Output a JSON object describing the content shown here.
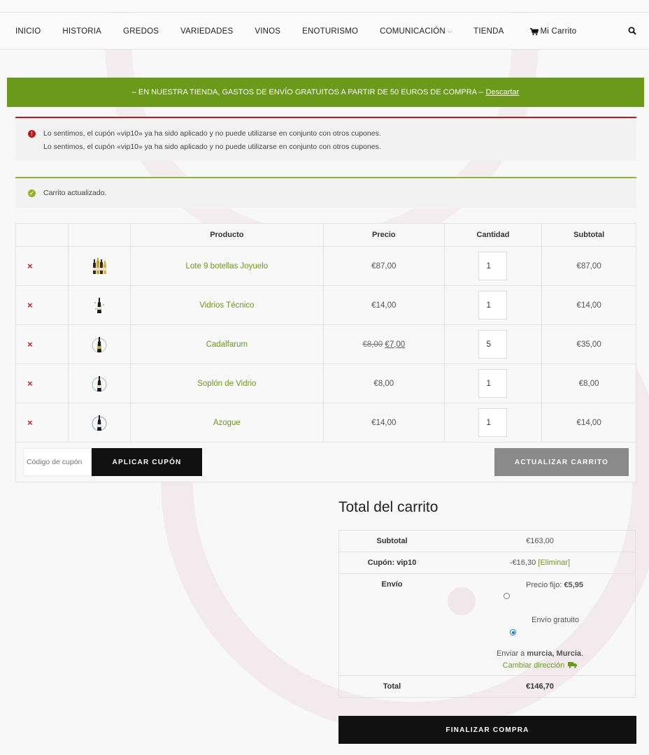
{
  "nav": {
    "items": [
      "INICIO",
      "HISTORIA",
      "GREDOS",
      "VARIEDADES",
      "VINOS",
      "ENOTURISMO",
      "COMUNICACIÓN",
      "TIENDA"
    ],
    "cart_label": "Mi Carrito"
  },
  "promo": {
    "text": "– EN NUESTRA TIENDA, GASTOS DE ENVÍO GRATUITOS A PARTIR DE 50 EUROS DE COMPRA –",
    "dismiss": "Descartar"
  },
  "notices": {
    "errors": [
      "Lo sentimos, el cupón «vip10» ya ha sido aplicado y no puede utilizarse en conjunto con otros cupones.",
      "Lo sentimos, el cupón «vip10» ya ha sido aplicado y no puede utilizarse en conjunto con otros cupones."
    ],
    "success": "Carrito actualizado."
  },
  "cart": {
    "headers": {
      "product": "Producto",
      "price": "Precio",
      "quantity": "Cantidad",
      "subtotal": "Subtotal"
    },
    "remove_symbol": "×",
    "items": [
      {
        "name": "Lote 9 botellas Joyuelo",
        "price": "€87,00",
        "old_price": "",
        "qty": "1",
        "subtotal": "€87,00"
      },
      {
        "name": "Vidrios Técnico",
        "price": "€14,00",
        "old_price": "",
        "qty": "1",
        "subtotal": "€14,00"
      },
      {
        "name": "Cadalfarum",
        "price": "€7,00",
        "old_price": "€8,00",
        "qty": "5",
        "subtotal": "€35,00"
      },
      {
        "name": "Soplón de Vidrio",
        "price": "€8,00",
        "old_price": "",
        "qty": "1",
        "subtotal": "€8,00"
      },
      {
        "name": "Azogue",
        "price": "€14,00",
        "old_price": "",
        "qty": "1",
        "subtotal": "€14,00"
      }
    ],
    "coupon_placeholder": "Código de cupón",
    "apply_coupon": "APLICAR CUPÓN",
    "update_cart": "ACTUALIZAR CARRITO"
  },
  "totals": {
    "title": "Total del carrito",
    "subtotal_label": "Subtotal",
    "subtotal_value": "€163,00",
    "coupon_label": "Cupón: vip10",
    "coupon_value": "-€16,30",
    "coupon_remove": "[Eliminar]",
    "shipping_label": "Envío",
    "ship_flat_prefix": "Precio fijo:",
    "ship_flat_price": "€5,95",
    "ship_free": "Envío gratuito",
    "ship_to_prefix": "Enviar a",
    "ship_to_place": "murcia, Murcia",
    "change_address": "Cambiar dirección",
    "total_label": "Total",
    "total_value": "€146,70"
  },
  "checkout": "FINALIZAR COMPRA"
}
